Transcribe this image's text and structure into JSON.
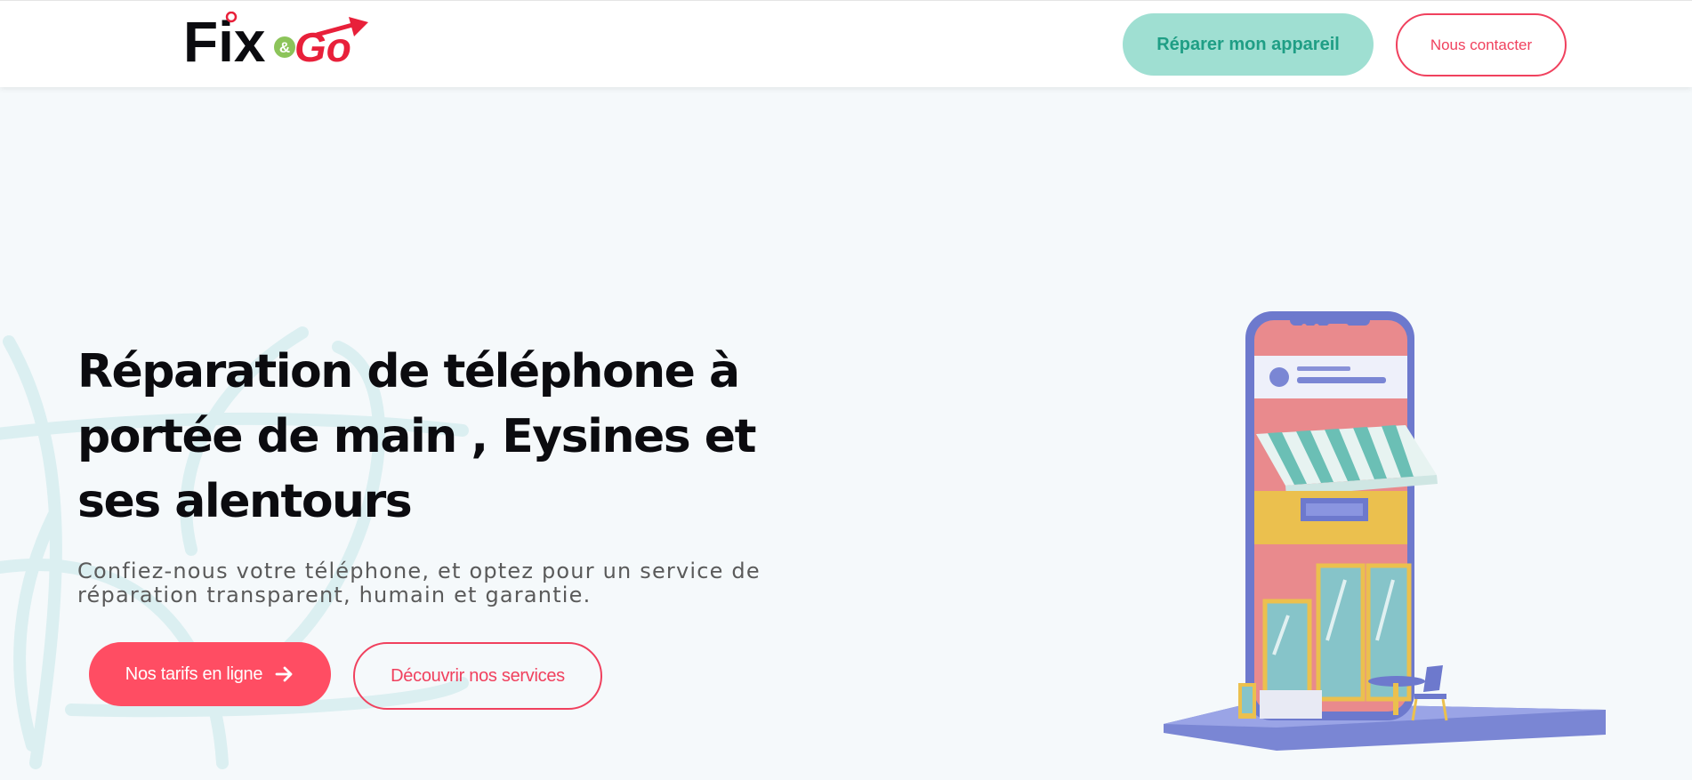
{
  "header": {
    "logo": {
      "word_fix": "Fix",
      "ampersand": "&",
      "word_go": "Go"
    },
    "repair_button": "Réparer mon appareil",
    "contact_button": "Nous contacter"
  },
  "hero": {
    "title": "Réparation de téléphone à portée de main , Eysines et ses alentours",
    "subtitle": "Confiez-nous votre téléphone, et optez pour un service de réparation transparent, humain et garantie.",
    "primary_button": "Nos tarifs en ligne",
    "primary_button_icon": "arrow-right-icon",
    "secondary_button": "Découvrir nos services"
  },
  "illustration": {
    "icon": "phone-storefront-illustration"
  },
  "colors": {
    "brand_red": "#f0415e",
    "primary_button_bg": "#ff4d63",
    "mint": "#9fdfd2",
    "mint_text": "#1f9e85",
    "page_bg": "#f5f9fb",
    "title": "#0b0b0f"
  }
}
